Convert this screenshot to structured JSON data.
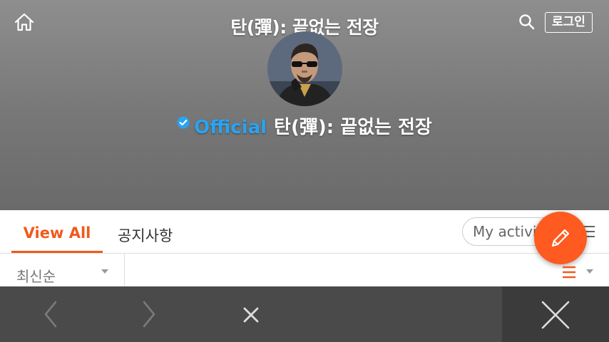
{
  "header": {
    "title": "탄(彈): 끝없는 전장",
    "login_label": "로그인",
    "channel_official": "Official",
    "channel_name": "탄(彈): 끝없는 전장"
  },
  "tabs": [
    {
      "label": "View All",
      "active": true
    },
    {
      "label": "공지사항",
      "active": false
    }
  ],
  "activity_select": {
    "label": "My activity"
  },
  "sort": {
    "selected": "최신순"
  },
  "colors": {
    "accent": "#f05a1e",
    "official": "#2aa3f0",
    "fab": "#ff5a1f",
    "bottom_bar": "#4a4a4a"
  },
  "icons": [
    "home-icon",
    "search-icon",
    "verified-badge-icon",
    "filter-icon",
    "pencil-icon",
    "list-view-icon",
    "chevron-left-icon",
    "chevron-right-icon",
    "close-icon"
  ]
}
